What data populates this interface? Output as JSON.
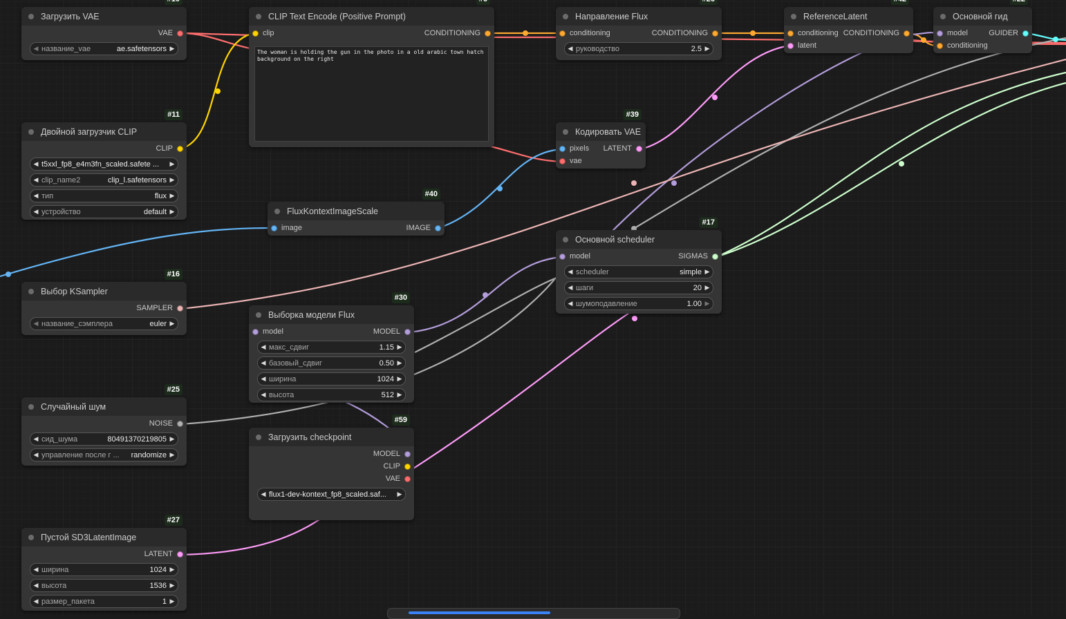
{
  "nodes": {
    "vae_loader": {
      "id": "#10",
      "title": "Загрузить VAE",
      "out": [
        "VAE"
      ],
      "widgets": [
        {
          "label": "название_vae",
          "value": "ae.safetensors"
        }
      ]
    },
    "dual_clip": {
      "id": "#11",
      "title": "Двойной загрузчик CLIP",
      "out": [
        "CLIP"
      ],
      "widgets": [
        {
          "label": "",
          "value": "t5xxl_fp8_e4m3fn_scaled.safete ..."
        },
        {
          "label": "clip_name2",
          "value": "clip_l.safetensors"
        },
        {
          "label": "тип",
          "value": "flux"
        },
        {
          "label": "устройство",
          "value": "default"
        }
      ]
    },
    "clip_encode": {
      "id": "#6",
      "title": "CLIP Text Encode (Positive Prompt)",
      "in": [
        "clip"
      ],
      "out": [
        "CONDITIONING"
      ],
      "text": "The woman is holding the gun in the photo in a old arabic town hatch background on the right"
    },
    "flux_guidance": {
      "id": "#26",
      "title": "Направление Flux",
      "in": [
        "conditioning"
      ],
      "out": [
        "CONDITIONING"
      ],
      "widgets": [
        {
          "label": "руководство",
          "value": "2.5"
        }
      ]
    },
    "ref_latent": {
      "id": "#42",
      "title": "ReferenceLatent",
      "in": [
        "conditioning",
        "latent"
      ],
      "out": [
        "CONDITIONING"
      ]
    },
    "basic_guider": {
      "id": "#22",
      "title": "Основной гид",
      "in": [
        "model",
        "conditioning"
      ],
      "out": [
        "GUIDER"
      ]
    },
    "vae_encode": {
      "id": "#39",
      "title": "Кодировать VAE",
      "in": [
        "pixels",
        "vae"
      ],
      "out": [
        "LATENT"
      ]
    },
    "image_scale": {
      "id": "#40",
      "title": "FluxKontextImageScale",
      "in": [
        "image"
      ],
      "out": [
        "IMAGE"
      ]
    },
    "sampler_select": {
      "id": "#16",
      "title": "Выбор KSampler",
      "out": [
        "SAMPLER"
      ],
      "widgets": [
        {
          "label": "название_сэмплера",
          "value": "euler"
        }
      ]
    },
    "model_sampling": {
      "id": "#30",
      "title": "Выборка модели Flux",
      "in": [
        "model"
      ],
      "out": [
        "MODEL"
      ],
      "widgets": [
        {
          "label": "макс_сдвиг",
          "value": "1.15"
        },
        {
          "label": "базовый_сдвиг",
          "value": "0.50"
        },
        {
          "label": "ширина",
          "value": "1024"
        },
        {
          "label": "высота",
          "value": "512"
        }
      ]
    },
    "scheduler": {
      "id": "#17",
      "title": "Основной scheduler",
      "in": [
        "model"
      ],
      "out": [
        "SIGMAS"
      ],
      "widgets": [
        {
          "label": "scheduler",
          "value": "simple"
        },
        {
          "label": "шаги",
          "value": "20"
        },
        {
          "label": "шумоподавление",
          "value": "1.00"
        }
      ]
    },
    "random_noise": {
      "id": "#25",
      "title": "Случайный шум",
      "out": [
        "NOISE"
      ],
      "widgets": [
        {
          "label": "сид_шума",
          "value": "80491370219805"
        },
        {
          "label": "управление после г ...",
          "value": "randomize"
        }
      ]
    },
    "checkpoint": {
      "id": "#59",
      "title": "Загрузить checkpoint",
      "out": [
        "MODEL",
        "CLIP",
        "VAE"
      ],
      "widgets": [
        {
          "label": "",
          "value": "flux1-dev-kontext_fp8_scaled.saf..."
        }
      ]
    },
    "empty_latent": {
      "id": "#27",
      "title": "Пустой SD3LatentImage",
      "out": [
        "LATENT"
      ],
      "widgets": [
        {
          "label": "ширина",
          "value": "1024"
        },
        {
          "label": "высота",
          "value": "1536"
        },
        {
          "label": "размер_пакета",
          "value": "1"
        }
      ]
    }
  },
  "colors": {
    "VAE": "#ff6e6e",
    "CLIP": "#ffd500",
    "CONDITIONING": "#ffa931",
    "LATENT": "#ff9cf9",
    "IMAGE": "#64b5f6",
    "MODEL": "#b39ddb",
    "SIGMAS": "#cdffcd",
    "GUIDER": "#66ffff",
    "SAMPLER": "#ecb4b4",
    "NOISE": "#b0b0b0"
  }
}
